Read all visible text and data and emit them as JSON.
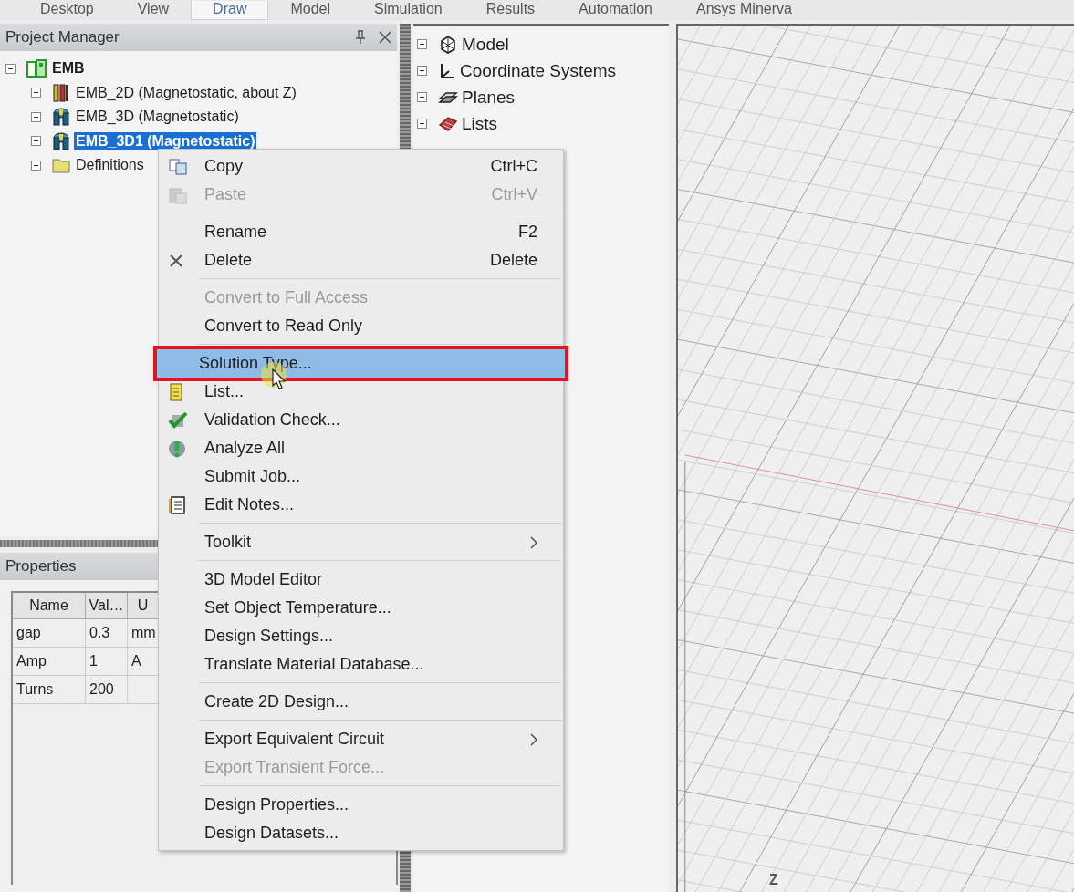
{
  "ribbon_tabs": [
    {
      "label": "Desktop",
      "selected": false
    },
    {
      "label": "View",
      "selected": false
    },
    {
      "label": "Draw",
      "selected": true
    },
    {
      "label": "Model",
      "selected": false
    },
    {
      "label": "Simulation",
      "selected": false
    },
    {
      "label": "Results",
      "selected": false
    },
    {
      "label": "Automation",
      "selected": false
    },
    {
      "label": "Ansys Minerva",
      "selected": false
    }
  ],
  "project_manager": {
    "title": "Project Manager",
    "tree": [
      {
        "label": "EMB",
        "kind": "project",
        "expanded": true,
        "selected": false,
        "children": [
          {
            "label": "EMB_2D (Magnetostatic, about Z)",
            "kind": "design2d",
            "expanded": false,
            "selected": false
          },
          {
            "label": "EMB_3D (Magnetostatic)",
            "kind": "design3d",
            "expanded": false,
            "selected": false
          },
          {
            "label": "EMB_3D1 (Magnetostatic)",
            "kind": "design3d",
            "expanded": false,
            "selected": true
          },
          {
            "label": "Definitions",
            "kind": "folder",
            "expanded": false,
            "selected": false
          }
        ]
      }
    ]
  },
  "properties": {
    "title": "Properties",
    "columns": [
      "Name",
      "Val…",
      "U"
    ],
    "rows": [
      {
        "name": "gap",
        "value": "0.3",
        "unit": "mm"
      },
      {
        "name": "Amp",
        "value": "1",
        "unit": "A"
      },
      {
        "name": "Turns",
        "value": "200"
      }
    ]
  },
  "model_tree": [
    {
      "label": "Model",
      "kind": "model",
      "expanded": false
    },
    {
      "label": "Coordinate Systems",
      "kind": "coordinates",
      "expanded": false
    },
    {
      "label": "Planes",
      "kind": "planes",
      "expanded": false
    },
    {
      "label": "Lists",
      "kind": "lists",
      "expanded": false
    }
  ],
  "context_menu": {
    "items": [
      {
        "kind": "copy",
        "label": "Copy",
        "shortcut": "Ctrl+C",
        "disabled": false,
        "selected": false,
        "annotated": false,
        "submenu": false
      },
      {
        "kind": "paste",
        "label": "Paste",
        "shortcut": "Ctrl+V",
        "disabled": true,
        "selected": false,
        "annotated": false,
        "submenu": false
      },
      {
        "kind": "separator"
      },
      {
        "kind": "item",
        "label": "Rename",
        "shortcut": "F2",
        "disabled": false,
        "selected": false,
        "annotated": false,
        "submenu": false
      },
      {
        "kind": "delete",
        "label": "Delete",
        "shortcut": "Delete",
        "disabled": false,
        "selected": false,
        "annotated": false,
        "submenu": false
      },
      {
        "kind": "separator"
      },
      {
        "kind": "item",
        "label": "Convert to Full Access",
        "disabled": true,
        "selected": false,
        "annotated": false,
        "submenu": false
      },
      {
        "kind": "item",
        "label": "Convert to Read Only",
        "disabled": false,
        "selected": false,
        "annotated": false,
        "submenu": false
      },
      {
        "kind": "separator"
      },
      {
        "kind": "item",
        "label": "Solution Type...",
        "disabled": false,
        "selected": true,
        "annotated": true,
        "submenu": false
      },
      {
        "kind": "list",
        "label": "List...",
        "disabled": false,
        "selected": false,
        "annotated": false,
        "submenu": false
      },
      {
        "kind": "check",
        "label": "Validation Check...",
        "disabled": false,
        "selected": false,
        "annotated": false,
        "submenu": false
      },
      {
        "kind": "analyze",
        "label": "Analyze All",
        "disabled": false,
        "selected": false,
        "annotated": false,
        "submenu": false
      },
      {
        "kind": "item",
        "label": "Submit Job...",
        "disabled": false,
        "selected": false,
        "annotated": false,
        "submenu": false
      },
      {
        "kind": "notes",
        "label": "Edit Notes...",
        "disabled": false,
        "selected": false,
        "annotated": false,
        "submenu": false
      },
      {
        "kind": "separator"
      },
      {
        "kind": "item",
        "label": "Toolkit",
        "disabled": false,
        "selected": false,
        "annotated": false,
        "submenu": true
      },
      {
        "kind": "separator"
      },
      {
        "kind": "item",
        "label": "3D Model Editor",
        "disabled": false,
        "selected": false,
        "annotated": false,
        "submenu": false
      },
      {
        "kind": "item",
        "label": "Set Object Temperature...",
        "disabled": false,
        "selected": false,
        "annotated": false,
        "submenu": false
      },
      {
        "kind": "item",
        "label": "Design Settings...",
        "disabled": false,
        "selected": false,
        "annotated": false,
        "submenu": false
      },
      {
        "kind": "item",
        "label": "Translate Material Database...",
        "disabled": false,
        "selected": false,
        "annotated": false,
        "submenu": false
      },
      {
        "kind": "separator"
      },
      {
        "kind": "item",
        "label": "Create 2D Design...",
        "disabled": false,
        "selected": false,
        "annotated": false,
        "submenu": false
      },
      {
        "kind": "separator"
      },
      {
        "kind": "item",
        "label": "Export Equivalent Circuit",
        "disabled": false,
        "selected": false,
        "annotated": false,
        "submenu": true
      },
      {
        "kind": "item",
        "label": "Export Transient Force...",
        "disabled": true,
        "selected": false,
        "annotated": false,
        "submenu": false
      },
      {
        "kind": "separator"
      },
      {
        "kind": "item",
        "label": "Design Properties...",
        "disabled": false,
        "selected": false,
        "annotated": false,
        "submenu": false
      },
      {
        "kind": "item",
        "label": "Design Datasets...",
        "disabled": false,
        "selected": false,
        "annotated": false,
        "submenu": false
      }
    ]
  },
  "viewport": {
    "axis_label": "Z"
  }
}
